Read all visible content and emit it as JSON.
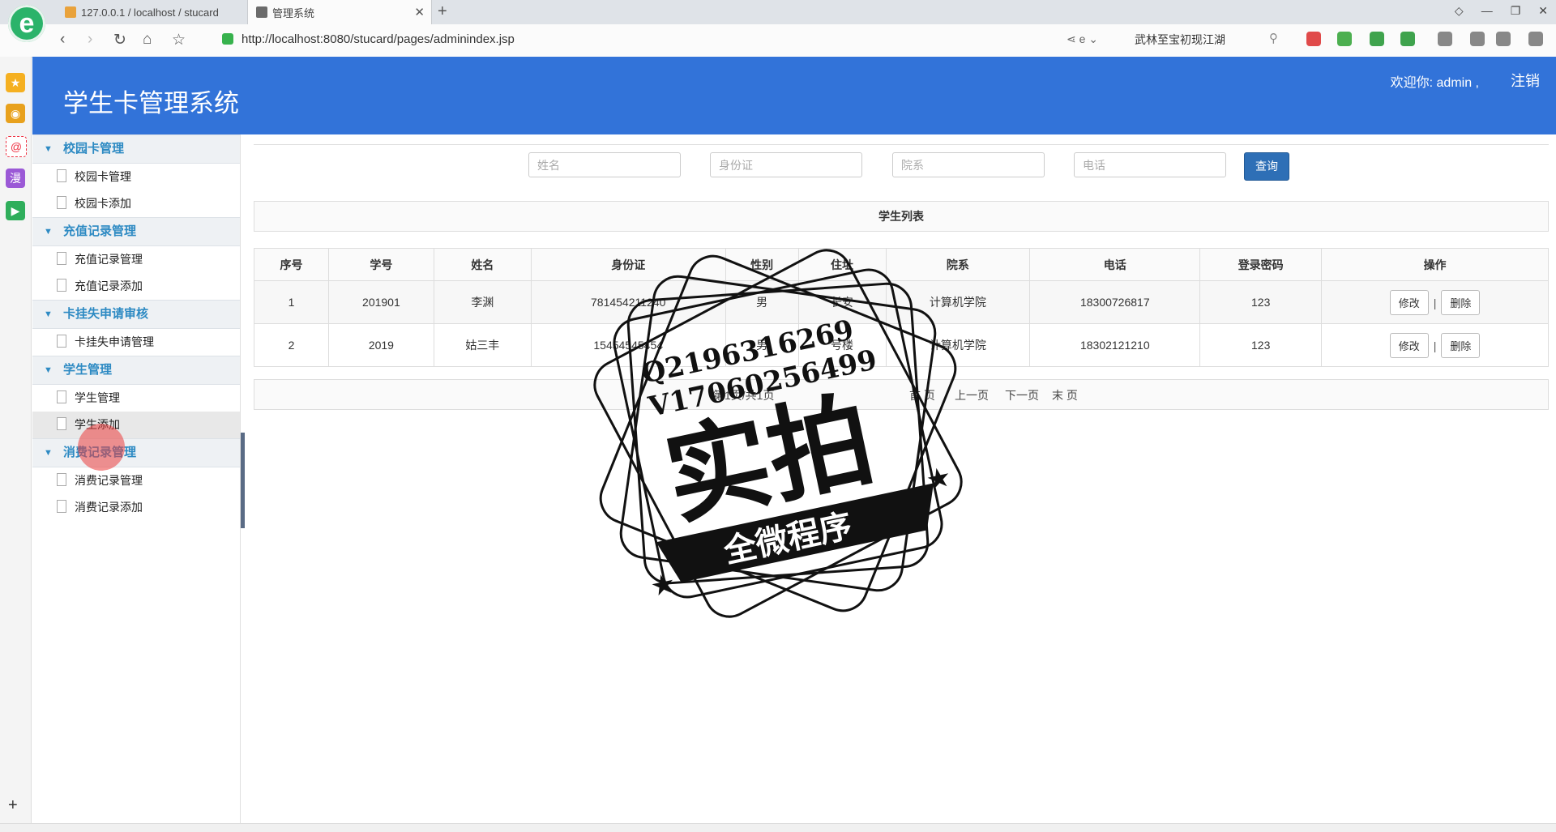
{
  "browser": {
    "tabs": [
      {
        "title": "127.0.0.1 / localhost / stucard"
      },
      {
        "title": "管理系统"
      }
    ],
    "url": "http://localhost:8080/stucard/pages/adminindex.jsp",
    "search_text": "武林至宝初现江湖"
  },
  "app": {
    "title": "学生卡管理系统",
    "welcome": "欢迎你: admin ,",
    "logout": "注销"
  },
  "sidebar": {
    "groups": [
      {
        "label": "校园卡管理",
        "items": [
          "校园卡管理",
          "校园卡添加"
        ]
      },
      {
        "label": "充值记录管理",
        "items": [
          "充值记录管理",
          "充值记录添加"
        ]
      },
      {
        "label": "卡挂失申请审核",
        "items": [
          "卡挂失申请管理"
        ]
      },
      {
        "label": "学生管理",
        "items": [
          "学生管理",
          "学生添加"
        ]
      },
      {
        "label": "消费记录管理",
        "items": [
          "消费记录管理",
          "消费记录添加"
        ]
      }
    ]
  },
  "search": {
    "name_placeholder": "姓名",
    "id_placeholder": "身份证",
    "dept_placeholder": "院系",
    "phone_placeholder": "电话",
    "button": "查询"
  },
  "list_title": "学生列表",
  "table": {
    "headers": [
      "序号",
      "学号",
      "姓名",
      "身份证",
      "性别",
      "住址",
      "院系",
      "电话",
      "登录密码",
      "操作"
    ],
    "rows": [
      {
        "no": "1",
        "sid": "201901",
        "name": "李渊",
        "idcard": "781454211240",
        "gender": "男",
        "addr": "长安",
        "dept": "计算机学院",
        "phone": "18300726817",
        "pwd": "123"
      },
      {
        "no": "2",
        "sid": "2019",
        "name": "姑三丰",
        "idcard": "15454545454",
        "gender": "男",
        "addr": "号楼",
        "dept": "计算机学院",
        "phone": "18302121210",
        "pwd": "123"
      }
    ],
    "edit": "修改",
    "delete": "删除"
  },
  "pager": {
    "info": "第1页/共1页",
    "first": "首 页",
    "prev": "上一页",
    "next": "下一页",
    "last": "末 页"
  },
  "watermark": {
    "line1": "Q2196316269",
    "line2": "V17060256499",
    "big": "实拍",
    "ribbon": "全微程序"
  }
}
